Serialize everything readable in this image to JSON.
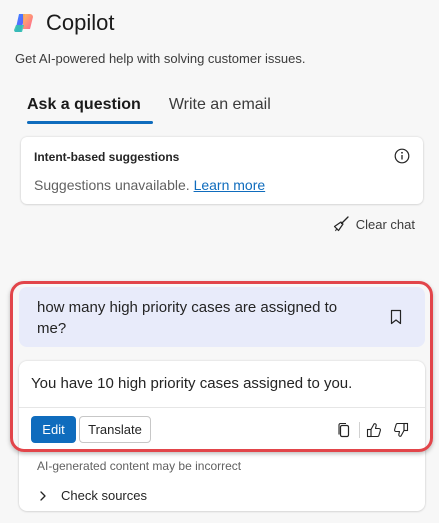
{
  "app": {
    "title": "Copilot",
    "subtitle": "Get AI-powered help with solving customer issues."
  },
  "tabs": [
    {
      "label": "Ask a question",
      "active": true
    },
    {
      "label": "Write an email",
      "active": false
    }
  ],
  "suggestions": {
    "title": "Intent-based suggestions",
    "message": "Suggestions unavailable.",
    "link": "Learn more"
  },
  "clear_chat": "Clear chat",
  "conversation": {
    "user_message": "how many high priority cases are assigned to me?",
    "response": "You have 10 high priority cases assigned to you.",
    "edit_label": "Edit",
    "translate_label": "Translate",
    "disclaimer": "AI-generated content may be incorrect",
    "sources_label": "Check sources"
  },
  "icons": {
    "info": "info-icon",
    "broom": "broom-icon",
    "bookmark": "bookmark-icon",
    "copy": "copy-icon",
    "thumbs_up": "thumbs-up-icon",
    "thumbs_down": "thumbs-down-icon",
    "chevron": "chevron-right-icon"
  },
  "colors": {
    "accent": "#0f6cbd",
    "user_bubble": "#e8ebfa",
    "highlight": "#e2454a"
  }
}
